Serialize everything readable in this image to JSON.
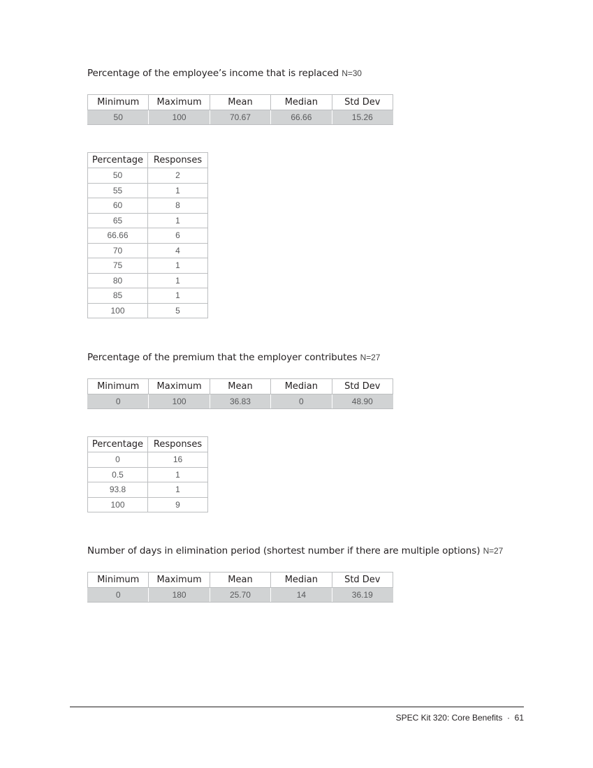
{
  "sections": [
    {
      "title": "Percentage of the employee’s income that is replaced",
      "n": "N=30",
      "stats": {
        "headers": [
          "Minimum",
          "Maximum",
          "Mean",
          "Median",
          "Std Dev"
        ],
        "values": [
          "50",
          "100",
          "70.67",
          "66.66",
          "15.26"
        ]
      },
      "distribution": {
        "headers": [
          "Percentage",
          "Responses"
        ],
        "rows": [
          [
            "50",
            "2"
          ],
          [
            "55",
            "1"
          ],
          [
            "60",
            "8"
          ],
          [
            "65",
            "1"
          ],
          [
            "66.66",
            "6"
          ],
          [
            "70",
            "4"
          ],
          [
            "75",
            "1"
          ],
          [
            "80",
            "1"
          ],
          [
            "85",
            "1"
          ],
          [
            "100",
            "5"
          ]
        ]
      }
    },
    {
      "title": "Percentage of the premium that the employer contributes",
      "n": "N=27",
      "stats": {
        "headers": [
          "Minimum",
          "Maximum",
          "Mean",
          "Median",
          "Std Dev"
        ],
        "values": [
          "0",
          "100",
          "36.83",
          "0",
          "48.90"
        ]
      },
      "distribution": {
        "headers": [
          "Percentage",
          "Responses"
        ],
        "rows": [
          [
            "0",
            "16"
          ],
          [
            "0.5",
            "1"
          ],
          [
            "93.8",
            "1"
          ],
          [
            "100",
            "9"
          ]
        ]
      }
    },
    {
      "title": "Number of days in elimination period (shortest number if there are multiple options)",
      "n": "N=27",
      "stats": {
        "headers": [
          "Minimum",
          "Maximum",
          "Mean",
          "Median",
          "Std Dev"
        ],
        "values": [
          "0",
          "180",
          "25.70",
          "14",
          "36.19"
        ]
      }
    }
  ],
  "footer": {
    "text": "SPEC Kit 320: Core Benefits  ·  61"
  }
}
